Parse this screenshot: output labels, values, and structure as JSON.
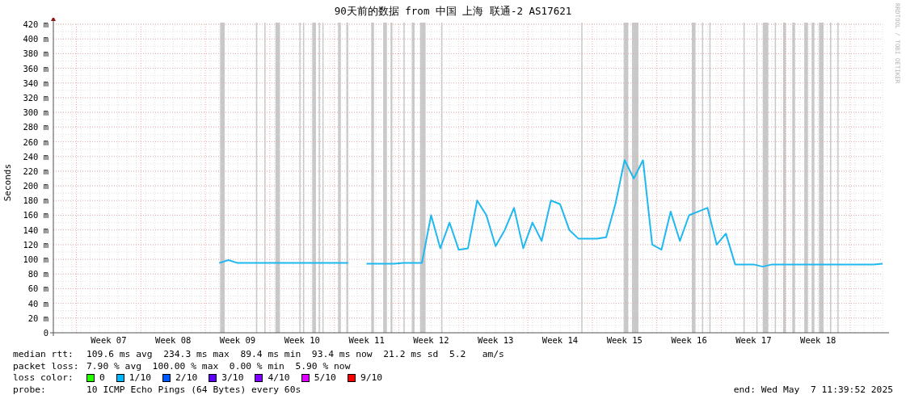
{
  "watermark_side_text": "RRDTOOL / TOBI OETIKER",
  "chart_data": {
    "type": "line",
    "title": "90天前的数据 from 中国 上海 联通-2 AS17621",
    "ylabel": "Seconds",
    "ylim": [
      0,
      420
    ],
    "grid": true,
    "categories": [
      null,
      null,
      null,
      null,
      null,
      null,
      "Week 07",
      null,
      null,
      null,
      null,
      null,
      null,
      "Week 08",
      null,
      null,
      null,
      null,
      null,
      null,
      "Week 09",
      null,
      null,
      null,
      null,
      null,
      null,
      "Week 10",
      null,
      null,
      null,
      null,
      null,
      null,
      "Week 11",
      null,
      null,
      null,
      null,
      null,
      null,
      "Week 12",
      null,
      null,
      null,
      null,
      null,
      null,
      "Week 13",
      null,
      null,
      null,
      null,
      null,
      null,
      "Week 14",
      null,
      null,
      null,
      null,
      null,
      null,
      "Week 15",
      null,
      null,
      null,
      null,
      null,
      null,
      "Week 16",
      null,
      null,
      null,
      null,
      null,
      null,
      "Week 17",
      null,
      null,
      null,
      null,
      null,
      null,
      "Week 18",
      null,
      null,
      null,
      null,
      null,
      null,
      null
    ],
    "series": [
      {
        "color": "#1fb8f0",
        "values": [
          null,
          null,
          null,
          null,
          null,
          null,
          null,
          null,
          null,
          null,
          null,
          null,
          null,
          null,
          null,
          null,
          null,
          null,
          95,
          99,
          95,
          95,
          95,
          95,
          95,
          95,
          95,
          95,
          95,
          95,
          95,
          95,
          95,
          null,
          94,
          94,
          94,
          94,
          95,
          95,
          95,
          160,
          115,
          150,
          113,
          115,
          180,
          160,
          118,
          140,
          170,
          115,
          150,
          125,
          180,
          175,
          140,
          128,
          128,
          128,
          130,
          175,
          235,
          210,
          235,
          120,
          113,
          165,
          125,
          160,
          165,
          170,
          120,
          135,
          93,
          93,
          93,
          90,
          93,
          93,
          93,
          93,
          93,
          93,
          93,
          93,
          93,
          93,
          93,
          93,
          94
        ]
      }
    ],
    "yticks": [
      {
        "value": 0,
        "label": "0"
      },
      {
        "value": 20,
        "label": "20 m"
      },
      {
        "value": 40,
        "label": "40 m"
      },
      {
        "value": 60,
        "label": "60 m"
      },
      {
        "value": 80,
        "label": "80 m"
      },
      {
        "value": 100,
        "label": "100 m"
      },
      {
        "value": 120,
        "label": "120 m"
      },
      {
        "value": 140,
        "label": "140 m"
      },
      {
        "value": 160,
        "label": "160 m"
      },
      {
        "value": 180,
        "label": "180 m"
      },
      {
        "value": 200,
        "label": "200 m"
      },
      {
        "value": 220,
        "label": "220 m"
      },
      {
        "value": 240,
        "label": "240 m"
      },
      {
        "value": 260,
        "label": "260 m"
      },
      {
        "value": 280,
        "label": "280 m"
      },
      {
        "value": 300,
        "label": "300 m"
      },
      {
        "value": 320,
        "label": "320 m"
      },
      {
        "value": 340,
        "label": "340 m"
      },
      {
        "value": 360,
        "label": "360 m"
      },
      {
        "value": 380,
        "label": "380 m"
      },
      {
        "value": 400,
        "label": "400 m"
      },
      {
        "value": 420,
        "label": "420 m"
      }
    ]
  },
  "legend": [
    {
      "kind": "stats",
      "label": "median rtt:",
      "value": "109.6 ms avg  234.3 ms max  89.4 ms min  93.4 ms now  21.2 ms sd  5.2   am/s"
    },
    {
      "kind": "stats",
      "label": "packet loss:",
      "value": "7.90 % avg  100.00 % max  0.00 % min  5.90 % now"
    },
    {
      "kind": "colors",
      "label": "loss color:",
      "items": [
        {
          "label": "0",
          "color": "#26ff00"
        },
        {
          "label": "1/10",
          "color": "#00b8ff"
        },
        {
          "label": "2/10",
          "color": "#0059ff"
        },
        {
          "label": "3/10",
          "color": "#5e00ff"
        },
        {
          "label": "4/10",
          "color": "#7e00ff"
        },
        {
          "label": "5/10",
          "color": "#dd00ff"
        },
        {
          "label": "9/10",
          "color": "#ff0000"
        }
      ]
    },
    {
      "kind": "stats",
      "label": "probe:",
      "value": "10 ICMP Echo Pings (64 Bytes) every 60s",
      "end": "end: Wed May  7 11:39:52 2025"
    }
  ]
}
